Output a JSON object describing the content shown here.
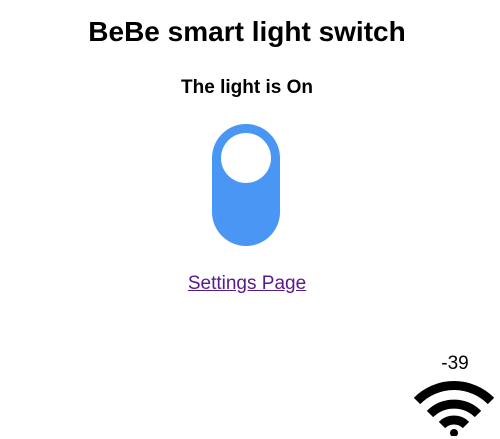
{
  "header": {
    "title": "BeBe smart light switch"
  },
  "light": {
    "status_text": "The light is On",
    "state": "on",
    "toggle_color": "#4a96f5"
  },
  "links": {
    "settings_label": "Settings Page"
  },
  "wifi": {
    "rssi": "-39",
    "icon": "wifi-icon",
    "strength_bars": 3
  }
}
